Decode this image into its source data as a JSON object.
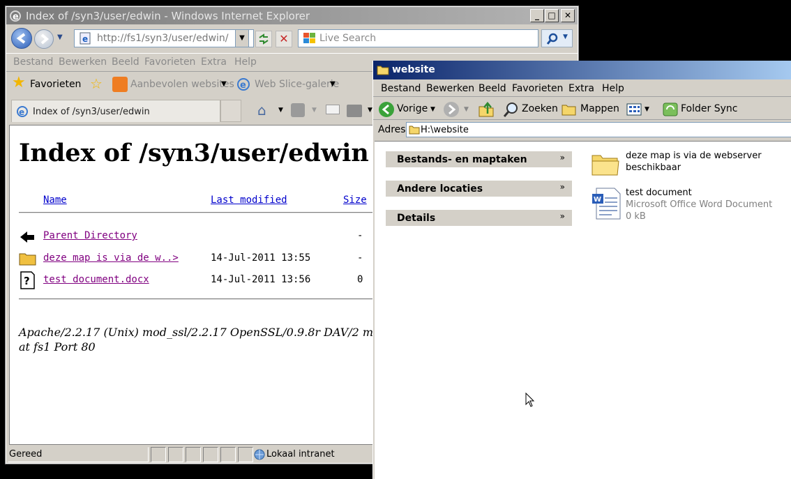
{
  "ie": {
    "window_title": "Index of /syn3/user/edwin - Windows Internet Explorer",
    "address": "http://fs1/syn3/user/edwin/",
    "search_placeholder": "Live Search",
    "menu": [
      "Bestand",
      "Bewerken",
      "Beeld",
      "Favorieten",
      "Extra",
      "Help"
    ],
    "favorites": {
      "label": "Favorieten",
      "items": [
        "Aanbevolen websites",
        "Web Slice-galerie"
      ]
    },
    "tab_title": "Index of /syn3/user/edwin",
    "page": {
      "heading": "Index of /syn3/user/edwin",
      "columns": {
        "name": "Name",
        "modified": "Last modified",
        "size": "Size"
      },
      "rows": [
        {
          "name": "Parent Directory",
          "modified": "",
          "size": "-",
          "icon": "back-arrow-icon"
        },
        {
          "name": "deze map is via de w..>",
          "modified": "14-Jul-2011 13:55",
          "size": "-",
          "icon": "folder-icon"
        },
        {
          "name": "test document.docx",
          "modified": "14-Jul-2011 13:56",
          "size": "0",
          "icon": "unknown-file-icon"
        }
      ],
      "footer_line1": "Apache/2.2.17 (Unix) mod_ssl/2.2.17 OpenSSL/0.9.8r DAV/2 m",
      "footer_line2": "at fs1 Port 80"
    },
    "status": {
      "text": "Gereed",
      "zone": "Lokaal intranet"
    }
  },
  "explorer": {
    "window_title": "website",
    "menu": [
      "Bestand",
      "Bewerken",
      "Beeld",
      "Favorieten",
      "Extra",
      "Help"
    ],
    "toolbar": {
      "back": "Vorige",
      "search": "Zoeken",
      "folders": "Mappen",
      "sync": "Folder Sync"
    },
    "address_label": "Adres",
    "address": "H:\\website",
    "tasks": [
      "Bestands- en maptaken",
      "Andere locaties",
      "Details"
    ],
    "items": [
      {
        "line1": "deze map is via de webserver",
        "line2": "beschikbaar",
        "icon": "folder-icon"
      },
      {
        "name": "test document",
        "type": "Microsoft Office Word Document",
        "size": "0 kB",
        "icon": "word-document-icon"
      }
    ]
  }
}
